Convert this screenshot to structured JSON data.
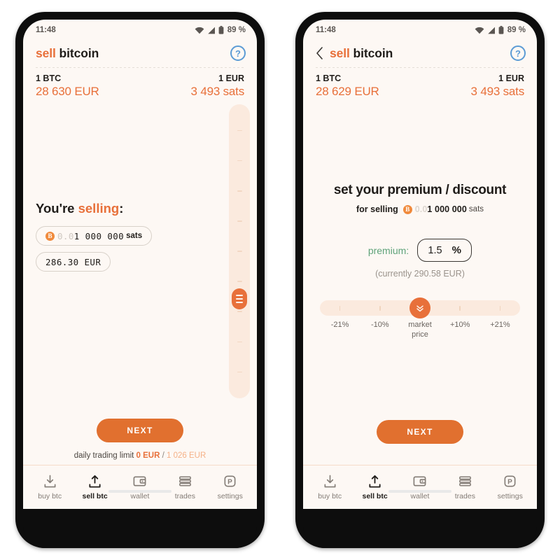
{
  "status_bar": {
    "time": "11:48",
    "battery_percent": "89 %",
    "icons": [
      "wifi-icon",
      "cellular-signal-icon",
      "battery-icon"
    ]
  },
  "colors": {
    "accent_orange": "#e8703a",
    "button_orange": "#e1702f",
    "track_peach": "#fbeade",
    "screen_bg": "#fdf8f4",
    "help_blue": "#5b9bd5",
    "premium_green": "#5fa37a"
  },
  "screen_left": {
    "header": {
      "title_accent": "sell",
      "title_rest": " bitcoin",
      "help_label": "?"
    },
    "rates": {
      "left_label": "1 BTC",
      "right_label": "1 EUR",
      "left_value": "28 630 EUR",
      "right_value": "3 493 sats"
    },
    "selling": {
      "title_prefix": "You're ",
      "title_accent": "selling",
      "title_suffix": ":",
      "amount_btc_icon": "B",
      "amount_dim_prefix": "0.0",
      "amount_value": "1 000 000",
      "amount_unit": "sats",
      "fiat_value": "286.30 EUR"
    },
    "slider": {
      "orientation": "vertical",
      "handle_icon": "drag-handle-icon",
      "tick_count": 9
    },
    "footer": {
      "next_label": "NEXT",
      "limit_prefix": "daily trading limit",
      "limit_used": "0 EUR",
      "limit_separator": "/",
      "limit_total": "1 026 EUR"
    }
  },
  "screen_right": {
    "header": {
      "back_icon": "chevron-left-icon",
      "title_accent": "sell",
      "title_rest": " bitcoin",
      "help_label": "?"
    },
    "rates": {
      "left_label": "1 BTC",
      "right_label": "1 EUR",
      "left_value": "28 629 EUR",
      "right_value": "3 493 sats"
    },
    "premium": {
      "heading": "set your premium / discount",
      "for_selling_label": "for selling",
      "btc_icon": "B",
      "amount_dim_prefix": "0.0",
      "amount_value": "1 000 000",
      "amount_unit": "sats",
      "input_label": "premium:",
      "input_value": "1.5",
      "input_suffix": "%",
      "currently": "(currently 290.58 EUR)"
    },
    "slider": {
      "orientation": "horizontal",
      "handle_icon": "double-chevron-down-icon",
      "ticks": [
        "-21%",
        "-10%",
        "market\nprice",
        "+10%",
        "+21%"
      ],
      "labels": [
        {
          "line1": "-21%",
          "line2": ""
        },
        {
          "line1": "-10%",
          "line2": ""
        },
        {
          "line1": "market",
          "line2": "price"
        },
        {
          "line1": "+10%",
          "line2": ""
        },
        {
          "line1": "+21%",
          "line2": ""
        }
      ],
      "selected_index": 2
    },
    "footer": {
      "next_label": "NEXT"
    }
  },
  "bottom_nav": {
    "items": [
      {
        "label": "buy btc",
        "icon": "download-arrow-icon",
        "active": false
      },
      {
        "label": "sell btc",
        "icon": "upload-arrow-icon",
        "active": true
      },
      {
        "label": "wallet",
        "icon": "wallet-icon",
        "active": false
      },
      {
        "label": "trades",
        "icon": "stacked-bars-icon",
        "active": false
      },
      {
        "label": "settings",
        "icon": "peach-settings-icon",
        "active": false
      }
    ]
  }
}
